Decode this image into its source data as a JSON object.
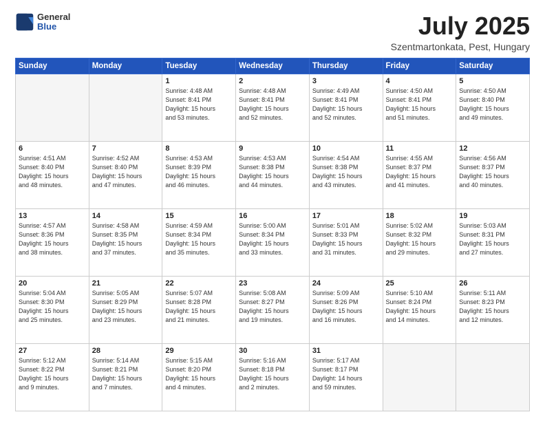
{
  "header": {
    "logo_general": "General",
    "logo_blue": "Blue",
    "title": "July 2025",
    "subtitle": "Szentmartonkata, Pest, Hungary"
  },
  "days_of_week": [
    "Sunday",
    "Monday",
    "Tuesday",
    "Wednesday",
    "Thursday",
    "Friday",
    "Saturday"
  ],
  "weeks": [
    [
      {
        "day": "",
        "info": ""
      },
      {
        "day": "",
        "info": ""
      },
      {
        "day": "1",
        "info": "Sunrise: 4:48 AM\nSunset: 8:41 PM\nDaylight: 15 hours\nand 53 minutes."
      },
      {
        "day": "2",
        "info": "Sunrise: 4:48 AM\nSunset: 8:41 PM\nDaylight: 15 hours\nand 52 minutes."
      },
      {
        "day": "3",
        "info": "Sunrise: 4:49 AM\nSunset: 8:41 PM\nDaylight: 15 hours\nand 52 minutes."
      },
      {
        "day": "4",
        "info": "Sunrise: 4:50 AM\nSunset: 8:41 PM\nDaylight: 15 hours\nand 51 minutes."
      },
      {
        "day": "5",
        "info": "Sunrise: 4:50 AM\nSunset: 8:40 PM\nDaylight: 15 hours\nand 49 minutes."
      }
    ],
    [
      {
        "day": "6",
        "info": "Sunrise: 4:51 AM\nSunset: 8:40 PM\nDaylight: 15 hours\nand 48 minutes."
      },
      {
        "day": "7",
        "info": "Sunrise: 4:52 AM\nSunset: 8:40 PM\nDaylight: 15 hours\nand 47 minutes."
      },
      {
        "day": "8",
        "info": "Sunrise: 4:53 AM\nSunset: 8:39 PM\nDaylight: 15 hours\nand 46 minutes."
      },
      {
        "day": "9",
        "info": "Sunrise: 4:53 AM\nSunset: 8:38 PM\nDaylight: 15 hours\nand 44 minutes."
      },
      {
        "day": "10",
        "info": "Sunrise: 4:54 AM\nSunset: 8:38 PM\nDaylight: 15 hours\nand 43 minutes."
      },
      {
        "day": "11",
        "info": "Sunrise: 4:55 AM\nSunset: 8:37 PM\nDaylight: 15 hours\nand 41 minutes."
      },
      {
        "day": "12",
        "info": "Sunrise: 4:56 AM\nSunset: 8:37 PM\nDaylight: 15 hours\nand 40 minutes."
      }
    ],
    [
      {
        "day": "13",
        "info": "Sunrise: 4:57 AM\nSunset: 8:36 PM\nDaylight: 15 hours\nand 38 minutes."
      },
      {
        "day": "14",
        "info": "Sunrise: 4:58 AM\nSunset: 8:35 PM\nDaylight: 15 hours\nand 37 minutes."
      },
      {
        "day": "15",
        "info": "Sunrise: 4:59 AM\nSunset: 8:34 PM\nDaylight: 15 hours\nand 35 minutes."
      },
      {
        "day": "16",
        "info": "Sunrise: 5:00 AM\nSunset: 8:34 PM\nDaylight: 15 hours\nand 33 minutes."
      },
      {
        "day": "17",
        "info": "Sunrise: 5:01 AM\nSunset: 8:33 PM\nDaylight: 15 hours\nand 31 minutes."
      },
      {
        "day": "18",
        "info": "Sunrise: 5:02 AM\nSunset: 8:32 PM\nDaylight: 15 hours\nand 29 minutes."
      },
      {
        "day": "19",
        "info": "Sunrise: 5:03 AM\nSunset: 8:31 PM\nDaylight: 15 hours\nand 27 minutes."
      }
    ],
    [
      {
        "day": "20",
        "info": "Sunrise: 5:04 AM\nSunset: 8:30 PM\nDaylight: 15 hours\nand 25 minutes."
      },
      {
        "day": "21",
        "info": "Sunrise: 5:05 AM\nSunset: 8:29 PM\nDaylight: 15 hours\nand 23 minutes."
      },
      {
        "day": "22",
        "info": "Sunrise: 5:07 AM\nSunset: 8:28 PM\nDaylight: 15 hours\nand 21 minutes."
      },
      {
        "day": "23",
        "info": "Sunrise: 5:08 AM\nSunset: 8:27 PM\nDaylight: 15 hours\nand 19 minutes."
      },
      {
        "day": "24",
        "info": "Sunrise: 5:09 AM\nSunset: 8:26 PM\nDaylight: 15 hours\nand 16 minutes."
      },
      {
        "day": "25",
        "info": "Sunrise: 5:10 AM\nSunset: 8:24 PM\nDaylight: 15 hours\nand 14 minutes."
      },
      {
        "day": "26",
        "info": "Sunrise: 5:11 AM\nSunset: 8:23 PM\nDaylight: 15 hours\nand 12 minutes."
      }
    ],
    [
      {
        "day": "27",
        "info": "Sunrise: 5:12 AM\nSunset: 8:22 PM\nDaylight: 15 hours\nand 9 minutes."
      },
      {
        "day": "28",
        "info": "Sunrise: 5:14 AM\nSunset: 8:21 PM\nDaylight: 15 hours\nand 7 minutes."
      },
      {
        "day": "29",
        "info": "Sunrise: 5:15 AM\nSunset: 8:20 PM\nDaylight: 15 hours\nand 4 minutes."
      },
      {
        "day": "30",
        "info": "Sunrise: 5:16 AM\nSunset: 8:18 PM\nDaylight: 15 hours\nand 2 minutes."
      },
      {
        "day": "31",
        "info": "Sunrise: 5:17 AM\nSunset: 8:17 PM\nDaylight: 14 hours\nand 59 minutes."
      },
      {
        "day": "",
        "info": ""
      },
      {
        "day": "",
        "info": ""
      }
    ]
  ]
}
